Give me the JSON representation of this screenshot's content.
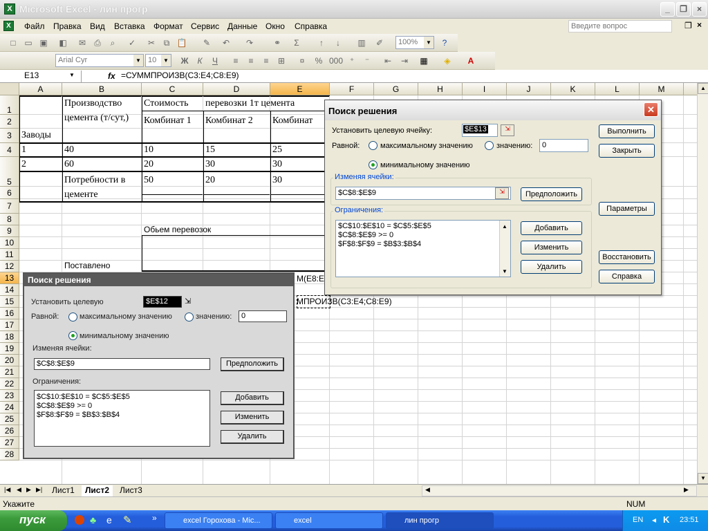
{
  "window": {
    "title": "Microsoft Excel - лин прогр"
  },
  "menu": [
    "Файл",
    "Правка",
    "Вид",
    "Вставка",
    "Формат",
    "Сервис",
    "Данные",
    "Окно",
    "Справка"
  ],
  "help_box": {
    "placeholder": "Введите вопрос"
  },
  "toolbar": {
    "zoom": "100%",
    "font": "Arial Cyr",
    "size": "10"
  },
  "formula_bar": {
    "name_box": "E13",
    "fx": "fx",
    "formula": "=СУММПРОИЗВ(C3:E4;C8:E9)"
  },
  "columns": [
    "A",
    "B",
    "C",
    "D",
    "E",
    "F",
    "G",
    "H",
    "I",
    "J",
    "K",
    "L",
    "M"
  ],
  "rows": [
    "1",
    "2",
    "3",
    "4",
    "5",
    "6",
    "7",
    "8",
    "9",
    "10",
    "11",
    "12",
    "13",
    "14",
    "15",
    "16",
    "17",
    "18",
    "19",
    "20",
    "21",
    "22",
    "23",
    "24",
    "25",
    "26",
    "27",
    "28"
  ],
  "cells": {
    "a2": "Заводы",
    "b1": "Производство",
    "b1b": "цемента (т/сут,)",
    "c1": "Стоимость",
    "d1": "перевозки    1т    цемента",
    "c2": "Комбинат 1",
    "d2": "Комбинат 2",
    "e2": "Комбинат",
    "a3": "1",
    "b3": "40",
    "c3": "10",
    "d3": "15",
    "e3": "25",
    "a4": "2",
    "b4": "60",
    "c4": "20",
    "d4": "30",
    "e4": "30",
    "b5": "Потребности    в",
    "b5b": "цементе",
    "c5": "50",
    "d5": "20",
    "e5": "30",
    "c7": "Обьем перевозок",
    "b10": "Поставлено",
    "e11": "М(E8:E",
    "e13": "МПРОИЗВ(C3:E4;C8:E9)"
  },
  "sheets": [
    "Лист1",
    "Лист2",
    "Лист3"
  ],
  "status": {
    "left": "Укажите",
    "num": "NUM"
  },
  "taskbar": {
    "start": "пуск",
    "tasks": [
      "excel Горохова - Mic...",
      "excel",
      "лин прогр"
    ],
    "lang": "EN",
    "time": "23:51"
  },
  "solver": {
    "title": "Поиск решения",
    "target_label": "Установить целевую ячейку:",
    "target_value": "$E$13",
    "equal_label": "Равной:",
    "max_label": "максимальному значению",
    "value_label": "значению:",
    "value_input": "0",
    "min_label": "минимальному значению",
    "changing_label": "Изменяя ячейки:",
    "changing_value": "$C$8:$E$9",
    "guess": "Предположить",
    "constraints_label": "Ограничения:",
    "constraints": [
      "$C$10:$E$10 = $C$5:$E$5",
      "$C$8:$E$9 >= 0",
      "$F$8:$F$9 = $B$3:$B$4"
    ],
    "add": "Добавить",
    "change": "Изменить",
    "delete": "Удалить",
    "solve": "Выполнить",
    "close": "Закрыть",
    "options": "Параметры",
    "reset": "Восстановить",
    "help": "Справка"
  },
  "scan": {
    "title": "Поиск решения",
    "target_label": "Установить целевую",
    "target_value": "$E$12",
    "equal_label": "Равной:",
    "max_label": "максимальному значению",
    "value_label": "значению:",
    "value_input": "0",
    "min_label": "минимальному значению",
    "changing_label": "Изменяя ячейки:",
    "changing_value": "$C$8:$E$9",
    "guess": "Предположить",
    "constraints_label": "Ограничения:",
    "constraints": [
      "$C$10:$E$10 = $C$5:$E$5",
      "$C$8:$E$9 >= 0",
      "$F$8:$F$9 = $B$3:$B$4"
    ],
    "add": "Добавить",
    "change": "Изменить",
    "delete": "Удалить"
  }
}
